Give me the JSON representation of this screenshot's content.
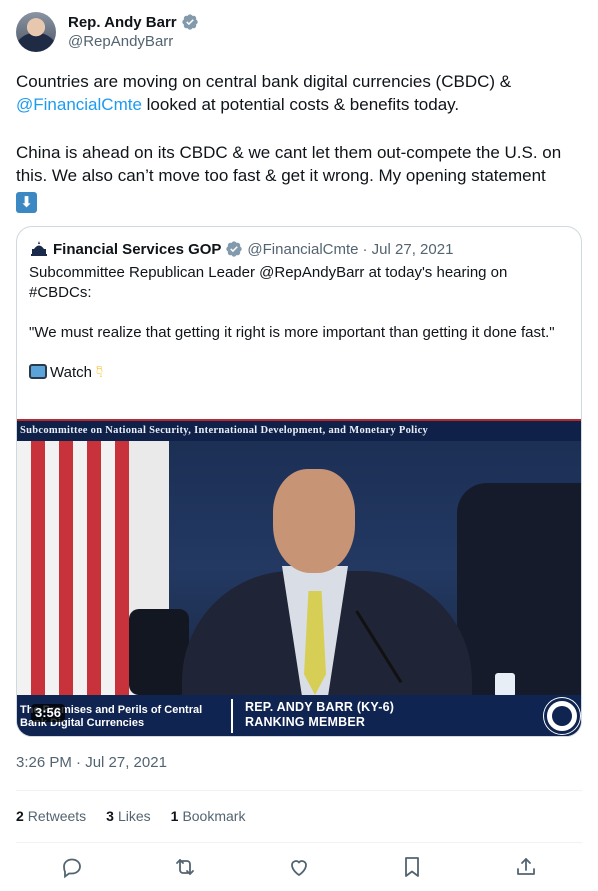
{
  "author": {
    "name": "Rep. Andy Barr",
    "handle": "@RepAndyBarr",
    "verified_icon": "verified-badge-icon",
    "accent": "#1d9bf0"
  },
  "tweet": {
    "p1_before": "Countries are moving on central bank digital currencies (CBDC) & ",
    "p1_mention": "@FinancialCmte",
    "p1_after": " looked at potential costs & benefits today.",
    "p2": "China is ahead on its CBDC & we cant let them out-compete the U.S. on this. We also can’t move too fast & get it wrong. My opening statement",
    "p2_emoji": "⬇",
    "timestamp": "3:26 PM · Jul 27, 2021"
  },
  "quote": {
    "name": "Financial Services GOP",
    "handle": "@FinancialCmte",
    "date": "· Jul 27, 2021",
    "line1": "Subcommittee Republican Leader @RepAndyBarr at today's hearing on #CBDCs:",
    "line2": "\"We must realize that getting it right is more important than getting it done fast.\"",
    "watch": "Watch",
    "video": {
      "banner": "Subcommittee on National Security, International Development, and Monetary Policy",
      "lower_left_1": "The Promises and Perils of Central",
      "lower_left_2": "Bank Digital Currencies",
      "lower_right_1": "REP. ANDY BARR (KY-6)",
      "lower_right_2": "RANKING MEMBER",
      "duration": "3:56"
    }
  },
  "stats": {
    "retweets_count": "2",
    "retweets_label": "Retweets",
    "likes_count": "3",
    "likes_label": "Likes",
    "bookmarks_count": "1",
    "bookmarks_label": "Bookmark"
  },
  "actions": [
    "reply-icon",
    "retweet-icon",
    "like-icon",
    "bookmark-icon",
    "share-icon"
  ]
}
